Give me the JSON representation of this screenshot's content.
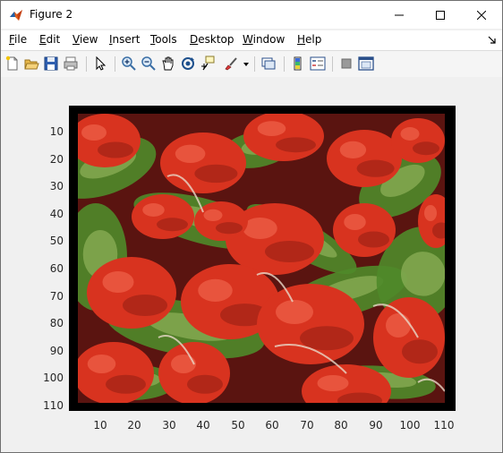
{
  "window": {
    "title": "Figure 2"
  },
  "menu": [
    {
      "key": "F",
      "rest": "ile"
    },
    {
      "key": "E",
      "rest": "dit"
    },
    {
      "key": "V",
      "rest": "iew"
    },
    {
      "key": "I",
      "rest": "nsert"
    },
    {
      "key": "T",
      "rest": "ools"
    },
    {
      "key": "D",
      "rest": "esktop"
    },
    {
      "key": "W",
      "rest": "indow"
    },
    {
      "key": "H",
      "rest": "elp"
    }
  ],
  "toolbar": {
    "buttons": [
      "new-figure-icon",
      "open-file-icon",
      "save-icon",
      "print-icon",
      "edit-plot-icon",
      "zoom-in-icon",
      "zoom-out-icon",
      "pan-icon",
      "rotate-3d-icon",
      "data-cursor-icon",
      "brush-icon",
      "link-plot-icon",
      "colorbar-icon",
      "legend-icon",
      "hide-plot-tools-icon",
      "show-plot-tools-icon"
    ]
  },
  "axes": {
    "yticks": [
      "10",
      "20",
      "30",
      "40",
      "50",
      "60",
      "70",
      "80",
      "90",
      "100",
      "110"
    ],
    "xticks": [
      "10",
      "20",
      "30",
      "40",
      "50",
      "60",
      "70",
      "80",
      "90",
      "100",
      "110"
    ]
  },
  "image": {
    "subject": "radishes",
    "palette": {
      "red": "#d8331f",
      "darkred": "#5a1410",
      "green": "#4f8a2a",
      "lightgreen": "#8fb25a",
      "white": "#e8d8c8"
    }
  }
}
